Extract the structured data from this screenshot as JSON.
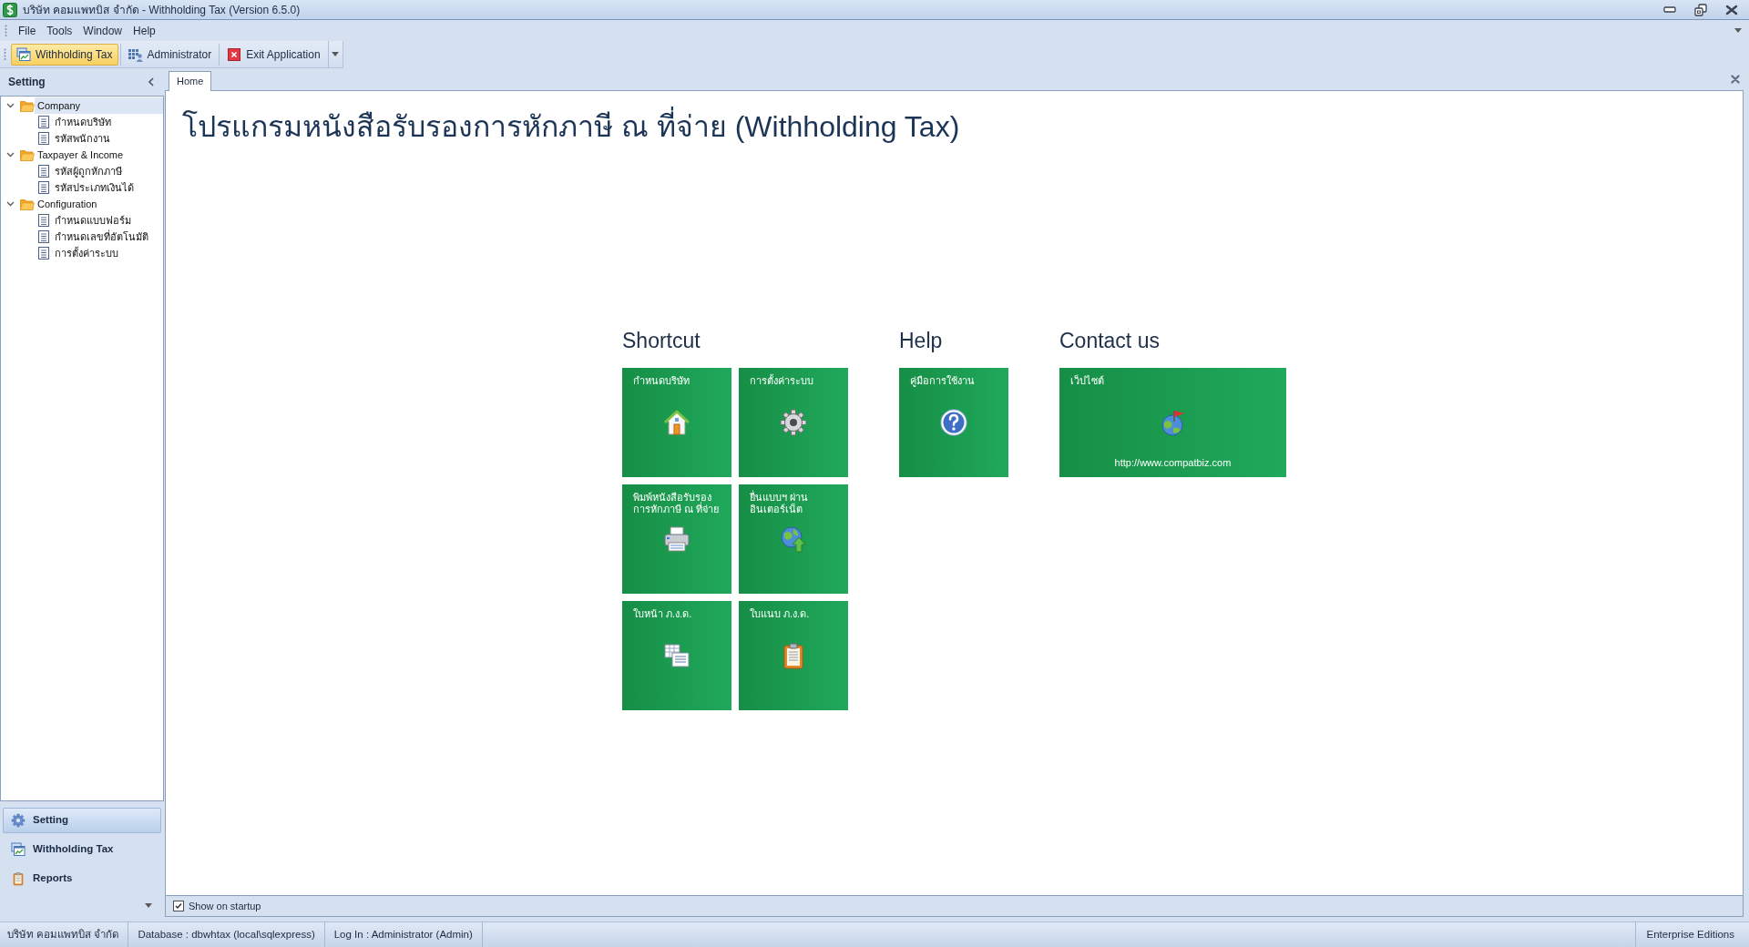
{
  "window": {
    "title": "บริษัท คอมแพทบิส จำกัด - Withholding Tax (Version 6.5.0)"
  },
  "menu": [
    {
      "label": "File"
    },
    {
      "label": "Tools"
    },
    {
      "label": "Window"
    },
    {
      "label": "Help"
    }
  ],
  "toolbar": [
    {
      "label": "Withholding Tax",
      "selected": true
    },
    {
      "label": "Administrator",
      "selected": false
    },
    {
      "label": "Exit Application",
      "selected": false
    }
  ],
  "sidebar": {
    "title": "Setting",
    "tree": [
      {
        "label": "Company",
        "expanded": true,
        "selected": true,
        "children": [
          {
            "label": "กำหนดบริษัท",
            "selected": false
          },
          {
            "label": "รหัสพนักงาน",
            "selected": false
          }
        ]
      },
      {
        "label": "Taxpayer & Income",
        "expanded": true,
        "selected": false,
        "children": [
          {
            "label": "รหัสผู้ถูกหักภาษี",
            "selected": false
          },
          {
            "label": "รหัสประเภทเงินได้",
            "selected": false
          }
        ]
      },
      {
        "label": "Configuration",
        "expanded": true,
        "selected": false,
        "children": [
          {
            "label": "กำหนดแบบฟอร์ม",
            "selected": false
          },
          {
            "label": "กำหนดเลขที่อัตโนมัติ",
            "selected": false
          },
          {
            "label": "การตั้งค่าระบบ",
            "selected": false
          }
        ]
      }
    ],
    "navigation": [
      {
        "label": "Setting",
        "selected": true
      },
      {
        "label": "Withholding Tax",
        "selected": false
      },
      {
        "label": "Reports",
        "selected": false
      }
    ]
  },
  "tabs": [
    {
      "label": "Home",
      "selected": true
    }
  ],
  "home": {
    "heading": "โปรแกรมหนังสือรับรองการหักภาษี ณ ที่จ่าย (Withholding Tax)",
    "sections": [
      {
        "title": "Shortcut",
        "tiles": [
          {
            "lines": [
              "กำหนดบริษัท"
            ]
          },
          {
            "lines": [
              "การตั้งค่าระบบ"
            ]
          },
          {
            "lines": [
              "พิมพ์หนังสือรับรอง",
              "การหักภาษี ณ ที่จ่าย"
            ]
          },
          {
            "lines": [
              "ยื่นแบบฯ ผ่าน",
              "อินเตอร์เน็ต"
            ]
          },
          {
            "lines": [
              "ใบหน้า ภ.ง.ด."
            ]
          },
          {
            "lines": [
              "ใบแนบ ภ.ง.ด."
            ]
          }
        ]
      },
      {
        "title": "Help",
        "tiles": [
          {
            "lines": [
              "คู่มือการใช้งาน"
            ]
          }
        ]
      },
      {
        "title": "Contact us",
        "tiles": [
          {
            "lines": [
              "เว็ปไซต์"
            ],
            "link": "http://www.compatbiz.com"
          }
        ]
      }
    ]
  },
  "show_on_startup": {
    "label": "Show on startup",
    "checked": true
  },
  "status_bar": [
    "บริษัท คอมแพทบิส จำกัด",
    "Database : dbwhtax (local\\sqlexpress)",
    "Log In : Administrator (Admin)",
    "Enterprise Editions"
  ]
}
